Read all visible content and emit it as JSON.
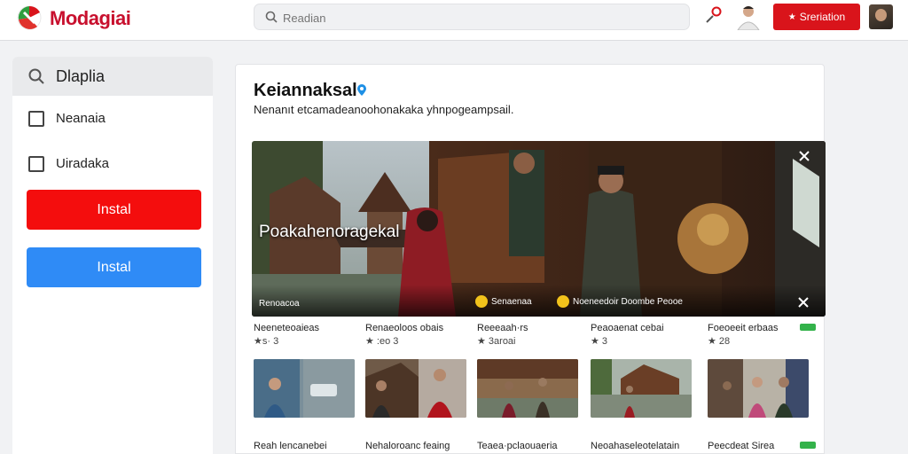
{
  "header": {
    "brand": "Modagiai",
    "search_placeholder": "Readian",
    "cta_label": "Sreriation"
  },
  "sidebar": {
    "search_label": "Dlaplia",
    "filters": [
      {
        "label": "Neanaia"
      },
      {
        "label": "Uiradaka"
      }
    ],
    "buttons": [
      {
        "label": "Instal",
        "color": "#f40d0d"
      },
      {
        "label": "Instal",
        "color": "#2f8bf6"
      }
    ]
  },
  "main": {
    "title": "Keiannaksal",
    "subtitle": "Nenanıt etcamadeanoohonakaka yhnpogeampsail.",
    "hero": {
      "caption": "Poakahenoragekal",
      "bottom_left": "Renoacoa",
      "chip1": "Senaenaa",
      "chip2": "Noeneedoir Doombe Peooe"
    },
    "items": [
      {
        "title": "Neeneteoaieas",
        "meta": "★s· 3"
      },
      {
        "title": "Renaeoloos obais",
        "meta": "★ :eo 3"
      },
      {
        "title": "Reeeaah·rs",
        "meta": "★ 3aroai"
      },
      {
        "title": "Peaoaenat cebai",
        "meta": "★ 3"
      },
      {
        "title": "Foeoeeit erbaas",
        "meta": "★ 28"
      }
    ],
    "row2": [
      "Reah lencanebei",
      "Nehaloroanc feaing",
      "Teaea·pclaouaeria",
      "Neoahaseleotelatain",
      "Peecdeat Sirea"
    ]
  },
  "colors": {
    "brand_red": "#c8102e",
    "button_red": "#f40d0d",
    "button_blue": "#2f8bf6",
    "cta_red": "#d9141b"
  }
}
